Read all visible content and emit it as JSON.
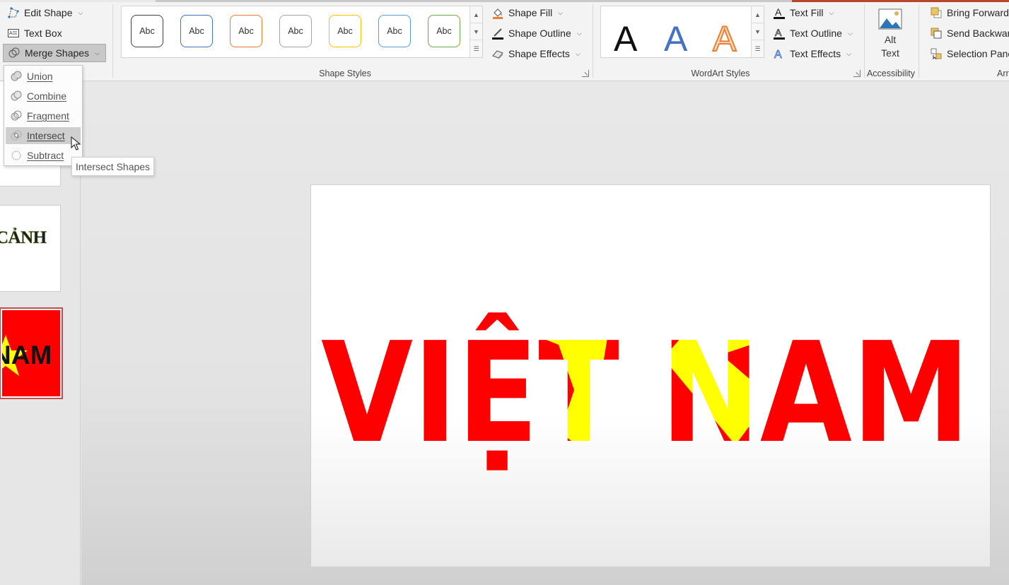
{
  "ribbon": {
    "insert_shapes": {
      "edit_shape": "Edit Shape",
      "text_box": "Text Box",
      "merge_shapes": "Merge Shapes"
    },
    "shape_styles": {
      "label": "Shape Styles",
      "presets": [
        "Abc",
        "Abc",
        "Abc",
        "Abc",
        "Abc",
        "Abc",
        "Abc"
      ],
      "preset_colors": [
        "#404040",
        "#4472c4",
        "#ed7d31",
        "#a5a5a5",
        "#ffc000",
        "#5b9bd5",
        "#70ad47"
      ],
      "shape_fill": "Shape Fill",
      "shape_outline": "Shape Outline",
      "shape_effects": "Shape Effects"
    },
    "wordart_styles": {
      "label": "WordArt Styles",
      "letters": [
        "A",
        "A",
        "A"
      ],
      "text_fill": "Text Fill",
      "text_outline": "Text Outline",
      "text_effects": "Text Effects"
    },
    "accessibility": {
      "label": "Accessibility",
      "alt_text_line1": "Alt",
      "alt_text_line2": "Text"
    },
    "arrange": {
      "bring_forward": "Bring Forward",
      "send_backward": "Send Backward",
      "selection_pane": "Selection Pane",
      "label_partial": "Arr"
    }
  },
  "merge_menu": {
    "items": [
      {
        "label": "Union",
        "icon": "union-icon"
      },
      {
        "label": "Combine",
        "icon": "combine-icon"
      },
      {
        "label": "Fragment",
        "icon": "fragment-icon"
      },
      {
        "label": "Intersect",
        "icon": "intersect-icon",
        "highlighted": true
      },
      {
        "label": "Subtract",
        "icon": "subtract-icon"
      }
    ],
    "tooltip": "Intersect Shapes"
  },
  "thumbnails": {
    "slide2_text": "CẢNH",
    "slide3_text": "NAM"
  },
  "slide": {
    "title_text": "VIỆT NAM",
    "colors": {
      "red": "#ff0000",
      "yellow": "#ffff00"
    }
  }
}
